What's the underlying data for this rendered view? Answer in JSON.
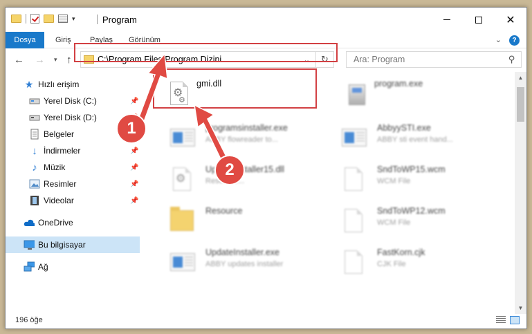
{
  "window": {
    "title": "Program"
  },
  "ribbon": {
    "tabs": [
      "Dosya",
      "Giriş",
      "Paylaş",
      "Görünüm"
    ],
    "help": "?"
  },
  "address": {
    "path": "C:\\Program Files\\Program Dizini"
  },
  "search": {
    "placeholder": "Ara: Program"
  },
  "sidebar": {
    "items": [
      {
        "label": "Hızlı erişim",
        "icon": "star-icon"
      },
      {
        "label": "Yerel Disk (C:)",
        "icon": "drive-icon",
        "pinned": true
      },
      {
        "label": "Yerel Disk (D:)",
        "icon": "drive-icon",
        "pinned": true
      },
      {
        "label": "Belgeler",
        "icon": "documents-icon",
        "pinned": true
      },
      {
        "label": "İndirmeler",
        "icon": "download-icon",
        "pinned": true
      },
      {
        "label": "Müzik",
        "icon": "music-icon",
        "pinned": true
      },
      {
        "label": "Resimler",
        "icon": "pictures-icon",
        "pinned": true
      },
      {
        "label": "Videolar",
        "icon": "videos-icon",
        "pinned": true
      },
      {
        "label": "OneDrive",
        "icon": "cloud-icon"
      },
      {
        "label": "Bu bilgisayar",
        "icon": "computer-icon",
        "selected": true
      },
      {
        "label": "Ağ",
        "icon": "network-icon"
      }
    ]
  },
  "files": [
    {
      "name": "gmi.dll",
      "desc": "",
      "icon": "dll-gear-icon"
    },
    {
      "name": "program.exe",
      "desc": "",
      "icon": "exe-icon"
    },
    {
      "name": "programsinstaller.exe",
      "desc": "ABBY flowreader to...",
      "icon": "app-window-icon"
    },
    {
      "name": "AbbyySTI.exe",
      "desc": "ABBY sti event hand...",
      "icon": "app-window-icon"
    },
    {
      "name": "UpdateInstaller15.dll",
      "desc": "Resource...",
      "icon": "dll-gear-icon"
    },
    {
      "name": "SndToWP15.wcm",
      "desc": "WCM File",
      "icon": "blank-file-icon"
    },
    {
      "name": "Resource",
      "desc": "",
      "icon": "folder-icon"
    },
    {
      "name": "SndToWP12.wcm",
      "desc": "WCM File",
      "icon": "blank-file-icon"
    },
    {
      "name": "UpdateInstaller.exe",
      "desc": "ABBY updates installer",
      "icon": "app-window-icon"
    },
    {
      "name": "FastKorn.cjk",
      "desc": "CJK File",
      "icon": "blank-file-icon"
    }
  ],
  "status": {
    "item_count": "196 öğe"
  },
  "annotations": {
    "badge1": "1",
    "badge2": "2",
    "highlight_color": "#d24043"
  }
}
